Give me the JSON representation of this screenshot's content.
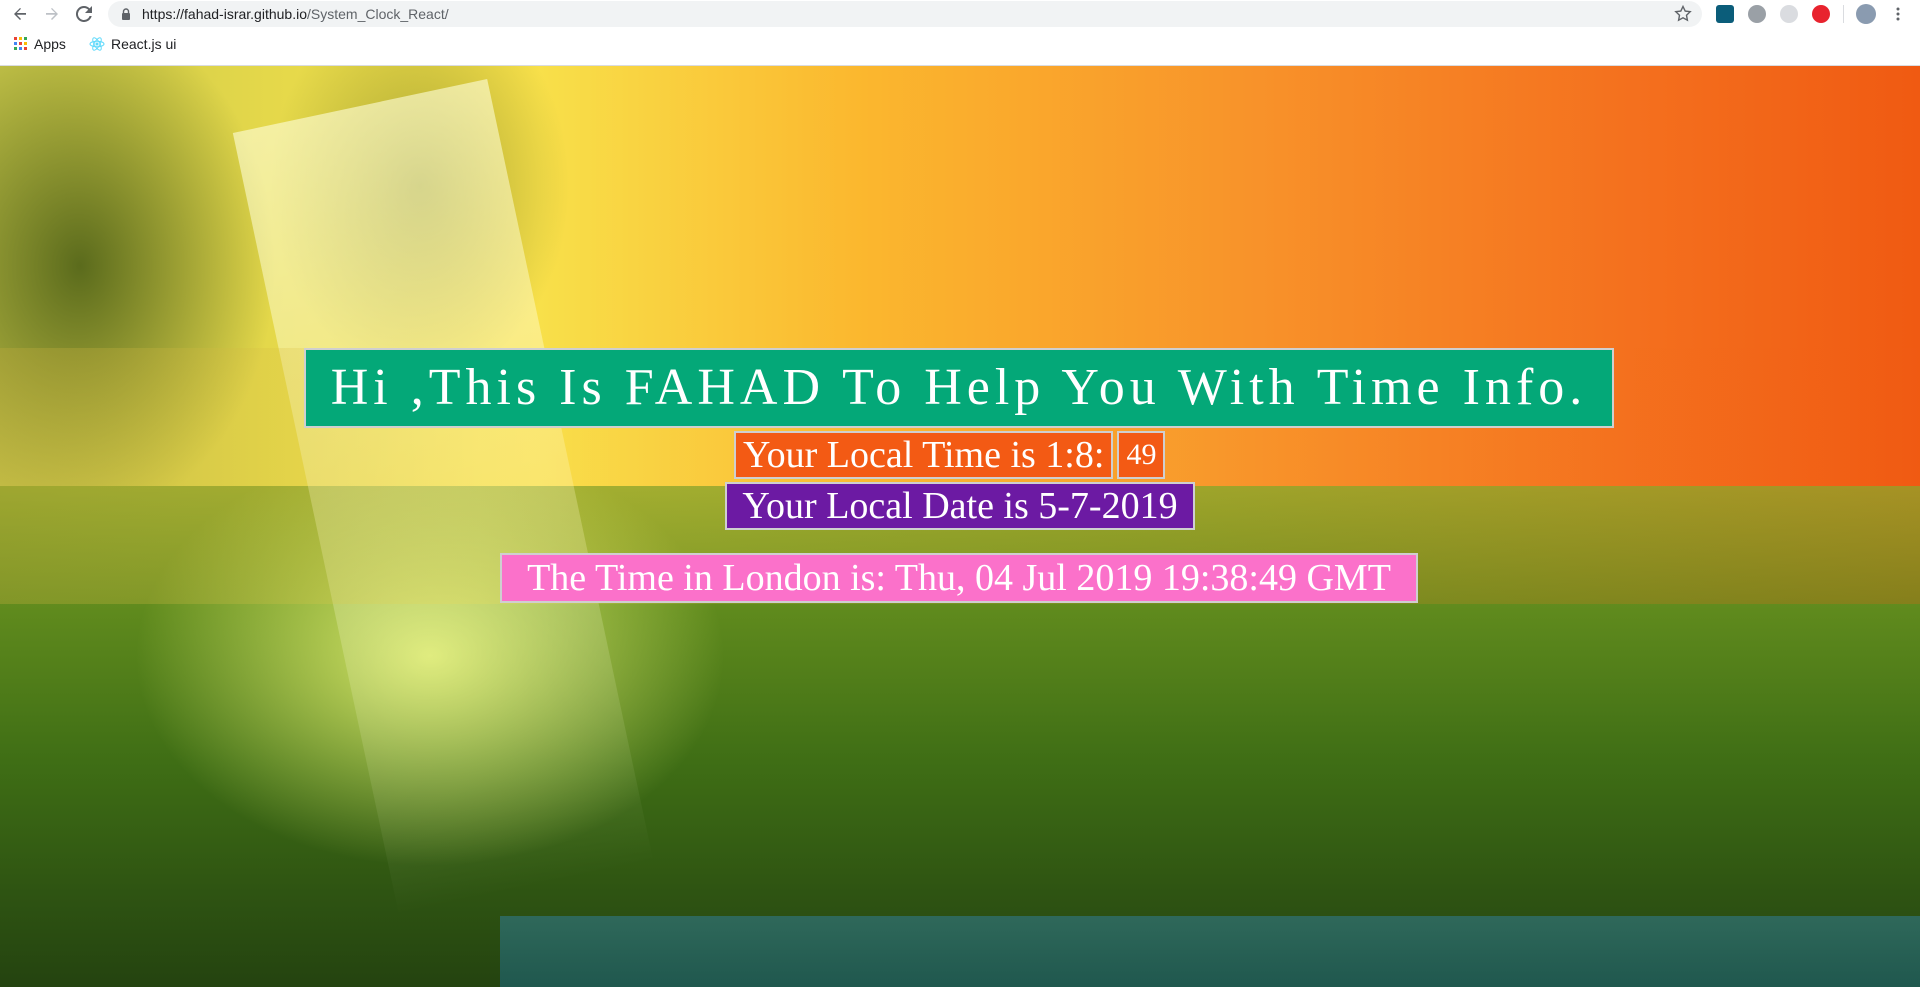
{
  "browser": {
    "url_host": "https://fahad-israr.github.io",
    "url_path": "/System_Clock_React/",
    "bookmarks": [
      {
        "label": "Apps",
        "icon": "apps-grid-icon"
      },
      {
        "label": "React.js ui",
        "icon": "react-icon"
      }
    ]
  },
  "clock": {
    "greeting": "Hi ,This Is FAHAD To Help You With Time Info.",
    "local_time_label": "Your Local Time is 1:8:",
    "local_time_seconds": "49",
    "local_date_label": "Your Local Date is 5-7-2019",
    "london_label": "The Time in London is: Thu, 04 Jul 2019 19:38:49 GMT"
  },
  "colors": {
    "greeting_bg": "#04a878",
    "time_bg": "#f35a14",
    "date_bg": "#6c1aa3",
    "london_bg": "#fb71ca"
  }
}
